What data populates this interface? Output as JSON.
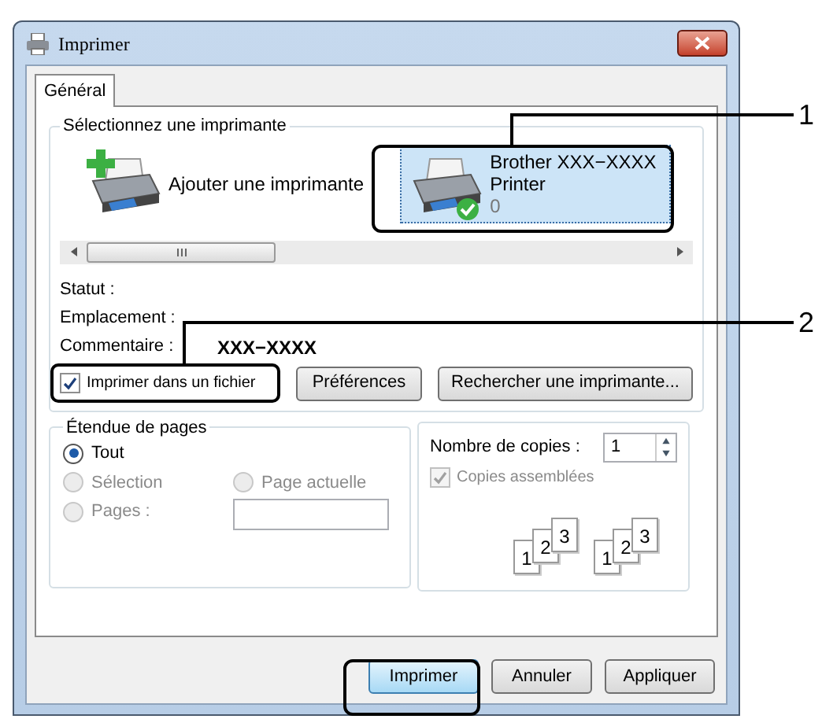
{
  "window": {
    "title": "Imprimer"
  },
  "tabs": [
    {
      "label": "Général",
      "selected": true
    }
  ],
  "printer_group": {
    "title": "Sélectionnez une imprimante",
    "printers": [
      {
        "kind": "add",
        "name": "Ajouter une imprimante",
        "selected": false
      },
      {
        "kind": "printer",
        "name": "Brother XXX−XXXX",
        "model": "Printer",
        "jobs": "0",
        "selected": true,
        "ready": true
      }
    ]
  },
  "details": [
    {
      "label": "Statut :"
    },
    {
      "label": "Emplacement :"
    },
    {
      "label": "Commentaire :",
      "value": "XXX−XXXX"
    }
  ],
  "print_to_file": {
    "label": "Imprimer dans un fichier",
    "checked": true
  },
  "printer_buttons": [
    "Préférences",
    "Rechercher une imprimante..."
  ],
  "page_range": {
    "title": "Étendue de pages",
    "options": [
      {
        "label": "Tout",
        "selected": true,
        "disabled": false
      },
      {
        "label": "Sélection",
        "selected": false,
        "disabled": true
      },
      {
        "label": "Page actuelle",
        "selected": false,
        "disabled": true
      },
      {
        "label": "Pages :",
        "selected": false,
        "disabled": true
      }
    ]
  },
  "copies": {
    "label": "Nombre de copies :",
    "value": "1",
    "collate": {
      "label": "Copies assemblées",
      "checked": true,
      "disabled": true
    },
    "stacks": [
      [
        "1",
        "2",
        "3"
      ],
      [
        "1",
        "2",
        "3"
      ]
    ]
  },
  "buttons": [
    {
      "label": "Imprimer",
      "default": true
    },
    {
      "label": "Annuler",
      "default": false
    },
    {
      "label": "Appliquer",
      "default": false
    }
  ],
  "callouts": [
    "1",
    "2"
  ]
}
